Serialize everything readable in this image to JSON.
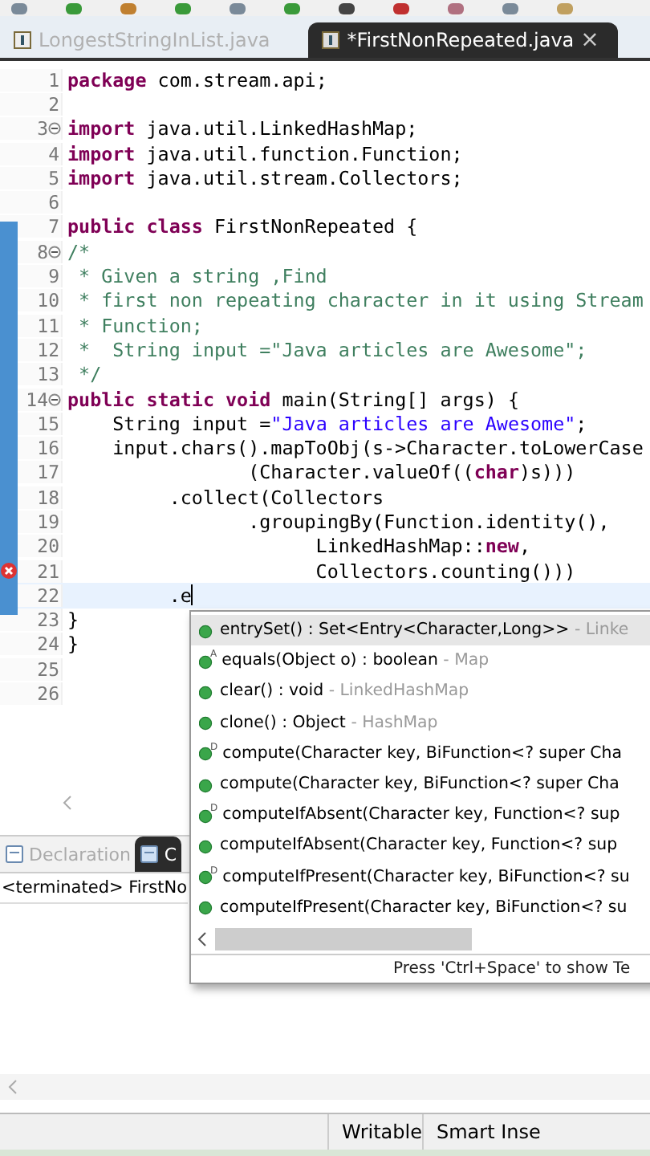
{
  "editor_tabs": [
    {
      "label": "LongestStringInList.java",
      "selected": false
    },
    {
      "label": "*FirstNonRepeated.java",
      "selected": true,
      "close": "×"
    }
  ],
  "editor": {
    "lines": [
      {
        "number": "1",
        "segments": [
          {
            "kind": "keyword",
            "text": "package"
          },
          {
            "kind": "plain",
            "text": " com.stream.api;"
          }
        ]
      },
      {
        "number": "2"
      },
      {
        "number": "3",
        "fold": true,
        "segments": [
          {
            "kind": "keyword",
            "text": "import"
          },
          {
            "kind": "plain",
            "text": " java.util.LinkedHashMap;"
          }
        ]
      },
      {
        "number": "4",
        "segments": [
          {
            "kind": "keyword",
            "text": "import"
          },
          {
            "kind": "plain",
            "text": " java.util.function.Function;"
          }
        ]
      },
      {
        "number": "5",
        "segments": [
          {
            "kind": "keyword",
            "text": "import"
          },
          {
            "kind": "plain",
            "text": " java.util.stream.Collectors;"
          }
        ]
      },
      {
        "number": "6"
      },
      {
        "number": "7",
        "segments": [
          {
            "kind": "keyword",
            "text": "public class"
          },
          {
            "kind": "plain",
            "text": " FirstNonRepeated {"
          }
        ]
      },
      {
        "number": "8",
        "fold": true,
        "segments": [
          {
            "kind": "comment",
            "text": "/*"
          }
        ]
      },
      {
        "number": "9",
        "segments": [
          {
            "kind": "comment",
            "text": " * Given a string ,Find"
          }
        ]
      },
      {
        "number": "10",
        "segments": [
          {
            "kind": "comment",
            "text": " * first non repeating character in it using Stream"
          }
        ]
      },
      {
        "number": "11",
        "segments": [
          {
            "kind": "comment",
            "text": " * Function;"
          }
        ]
      },
      {
        "number": "12",
        "segments": [
          {
            "kind": "comment",
            "text": " *  String input =\"Java articles are Awesome\";"
          }
        ]
      },
      {
        "number": "13",
        "segments": [
          {
            "kind": "comment",
            "text": " */"
          }
        ]
      },
      {
        "number": "14",
        "fold": true,
        "segments": [
          {
            "kind": "keyword",
            "text": "public static void"
          },
          {
            "kind": "plain",
            "text": " main(String[] args) {"
          }
        ]
      },
      {
        "number": "15",
        "segments": [
          {
            "kind": "plain",
            "text": "    String input ="
          },
          {
            "kind": "string",
            "text": "\"Java articles are Awesome\""
          },
          {
            "kind": "plain",
            "text": ";"
          }
        ]
      },
      {
        "number": "16",
        "segments": [
          {
            "kind": "plain",
            "text": "    input.chars().mapToObj(s->Character.toLowerCase"
          }
        ]
      },
      {
        "number": "17",
        "segments": [
          {
            "kind": "plain",
            "text": "                (Character.valueOf(("
          },
          {
            "kind": "keyword",
            "text": "char"
          },
          {
            "kind": "plain",
            "text": ")s)))"
          }
        ]
      },
      {
        "number": "18",
        "segments": [
          {
            "kind": "plain",
            "text": "         .collect(Collectors"
          }
        ]
      },
      {
        "number": "19",
        "segments": [
          {
            "kind": "plain",
            "text": "                .groupingBy(Function.identity(),"
          }
        ]
      },
      {
        "number": "20",
        "segments": [
          {
            "kind": "plain",
            "text": "                      LinkedHashMap::"
          },
          {
            "kind": "keyword",
            "text": "new"
          },
          {
            "kind": "plain",
            "text": ","
          }
        ]
      },
      {
        "number": "21",
        "error": true,
        "segments": [
          {
            "kind": "plain",
            "text": "                      Collectors.counting()))"
          }
        ]
      },
      {
        "number": "22",
        "current": true,
        "segments": [
          {
            "kind": "plain",
            "text": "         .e"
          }
        ]
      },
      {
        "number": "23",
        "segments": [
          {
            "kind": "plain",
            "text": "}"
          }
        ]
      },
      {
        "number": "24",
        "segments": [
          {
            "kind": "plain",
            "text": "}"
          }
        ]
      },
      {
        "number": "25"
      },
      {
        "number": "26"
      }
    ]
  },
  "completion": {
    "items": [
      {
        "name": "entrySet() : Set<Entry<Character,Long>>",
        "owner": "- Linke",
        "selected": true
      },
      {
        "name": "equals(Object o) : boolean",
        "owner": "- Map",
        "mark": "A",
        "selected": false
      },
      {
        "name": "clear() : void",
        "owner": "- LinkedHashMap",
        "selected": false
      },
      {
        "name": "clone() : Object",
        "owner": "- HashMap",
        "selected": false
      },
      {
        "name": "compute(Character key, BiFunction<? super Cha",
        "mark": "D",
        "selected": false
      },
      {
        "name": "compute(Character key, BiFunction<? super Cha",
        "selected": false
      },
      {
        "name": "computeIfAbsent(Character key, Function<? sup",
        "mark": "D",
        "selected": false
      },
      {
        "name": "computeIfAbsent(Character key, Function<? sup",
        "selected": false
      },
      {
        "name": "computeIfPresent(Character key, BiFunction<? su",
        "mark": "D",
        "selected": false
      },
      {
        "name": "computeIfPresent(Character key, BiFunction<? su",
        "selected": false
      }
    ],
    "footer": "Press 'Ctrl+Space' to show Te"
  },
  "bottom_panel": {
    "tabs": [
      {
        "label": "Declaration",
        "selected": false
      },
      {
        "label": "C",
        "selected": true
      }
    ],
    "console_line": "<terminated> FirstNo"
  },
  "status_bar": {
    "fields": [
      "Writable",
      "Smart Inse"
    ]
  }
}
